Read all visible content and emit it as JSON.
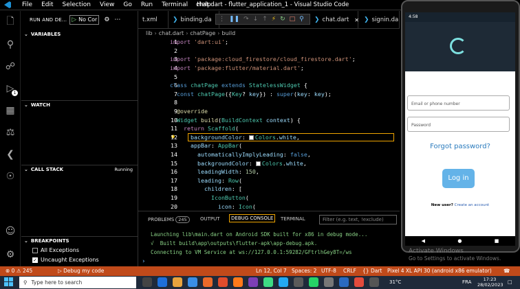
{
  "window": {
    "title": "chat.dart - flutter_application_1 - Visual Studio Code",
    "menu": [
      "File",
      "Edit",
      "Selection",
      "View",
      "Go",
      "Run",
      "Terminal",
      "Help"
    ]
  },
  "activity_bar": {
    "icons": [
      "explorer-icon",
      "search-icon",
      "source-control-icon",
      "run-debug-icon",
      "extensions-icon",
      "testing-icon",
      "flutter-icon",
      "remote-icon",
      "account-icon",
      "settings-icon"
    ],
    "debug_badge": "1"
  },
  "sidebar": {
    "run_label": "RUN AND DE...",
    "config_label": "No Cor",
    "sections": {
      "variables": "VARIABLES",
      "watch": "WATCH",
      "call_stack": "CALL STACK",
      "call_stack_status": "Running",
      "breakpoints": "BREAKPOINTS"
    },
    "breakpoints": [
      {
        "label": "All Exceptions",
        "checked": false
      },
      {
        "label": "Uncaught Exceptions",
        "checked": true
      }
    ]
  },
  "tabs": [
    {
      "label": "t.xml"
    },
    {
      "label": "binding.da"
    },
    {
      "label": "chat.dart"
    },
    {
      "label": "signin.da"
    }
  ],
  "breadcrumb": [
    "lib",
    "chat.dart",
    "chatPage",
    "build"
  ],
  "editor": {
    "line_numbers": [
      "1",
      "2",
      "3",
      "4",
      "5",
      "6",
      "7",
      "8",
      "9",
      "10",
      "11",
      "12",
      "13",
      "14",
      "15",
      "16",
      "17",
      "18",
      "19",
      "20"
    ],
    "active_line": "12"
  },
  "panel": {
    "tabs": [
      "PROBLEMS",
      "OUTPUT",
      "DEBUG CONSOLE",
      "TERMINAL"
    ],
    "problems_count": "245",
    "filter_placeholder": "Filter (e.g. text, !exclude)",
    "output_lines": [
      "Launching lib\\main.dart on Android SDK built for x86 in debug mode...",
      "√  Built build\\app\\outputs\\flutter-apk\\app-debug.apk.",
      "Connecting to VM Service at ws://127.0.0.1:59282/GFtrlhGey8T=/ws"
    ]
  },
  "emulator": {
    "status_time": "4:58",
    "email_placeholder": "Email or phone number",
    "password_placeholder": "Password",
    "forgot_label": "Forgot password?",
    "login_label": "Log in",
    "new_user_label": "New user?",
    "create_account_label": "Create an account"
  },
  "watermark": {
    "line1": "Activate Windows",
    "line2": "Go to Settings to activate Windows."
  },
  "statusbar": {
    "errors": "0",
    "warnings": "245",
    "debug_label": "Debug my code",
    "position": "Ln 12, Col 7",
    "spaces": "Spaces: 2",
    "encoding": "UTF-8",
    "eol": "CRLF",
    "language": "Dart",
    "device": "Pixel 4 XL API 30 (android x86 emulator)"
  },
  "taskbar": {
    "search_placeholder": "Type here to search",
    "temperature": "31°C",
    "lang": "FRA",
    "time": "17:23",
    "date": "28/02/2023"
  },
  "colors": {
    "statusbar": "#c04a1a",
    "accent": "#f0a500",
    "link": "#2a7bbd"
  }
}
